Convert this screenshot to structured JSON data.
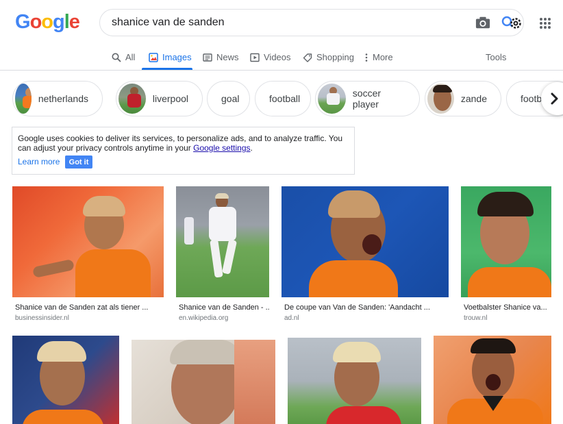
{
  "logo": {
    "text": "Google",
    "letters": [
      "G",
      "o",
      "o",
      "g",
      "l",
      "e"
    ],
    "colors": [
      "#4285f4",
      "#ea4335",
      "#fbbc05",
      "#4285f4",
      "#34a853",
      "#ea4335"
    ]
  },
  "search": {
    "value": "shanice van de sanden"
  },
  "tabs": [
    {
      "label": "All",
      "icon": "search-icon"
    },
    {
      "label": "Images",
      "icon": "image-icon",
      "active": true
    },
    {
      "label": "News",
      "icon": "news-icon"
    },
    {
      "label": "Videos",
      "icon": "play-icon"
    },
    {
      "label": "Shopping",
      "icon": "tag-icon"
    },
    {
      "label": "More",
      "icon": "more-vert-icon"
    }
  ],
  "tools_label": "Tools",
  "chips": [
    {
      "label": "netherlands",
      "has_thumb": true
    },
    {
      "label": "liverpool",
      "has_thumb": true
    },
    {
      "label": "goal",
      "has_thumb": false
    },
    {
      "label": "football",
      "has_thumb": false
    },
    {
      "label": "soccer player",
      "has_thumb": true
    },
    {
      "label": "zande",
      "has_thumb": true
    },
    {
      "label": "footba",
      "has_thumb": false
    }
  ],
  "cookie": {
    "text_before_link": "Google uses cookies to deliver its services, to personalize ads, and to analyze traffic. You can adjust your privacy controls anytime in your ",
    "link": "Google settings",
    "text_after_link": ".",
    "learn_more": "Learn more",
    "got_it": "Got it"
  },
  "results_row1": [
    {
      "caption": "Shanice van de Sanden zat als tiener ...",
      "source": "businessinsider.nl"
    },
    {
      "caption": "Shanice van de Sanden - ...",
      "source": "en.wikipedia.org"
    },
    {
      "caption": "De coupe van Van de Sanden: 'Aandacht ...",
      "source": "ad.nl"
    },
    {
      "caption": "Voetbalster Shanice va...",
      "source": "trouw.nl"
    }
  ],
  "colors": {
    "accent": "#1a73e8",
    "orange": "#f5791f"
  }
}
